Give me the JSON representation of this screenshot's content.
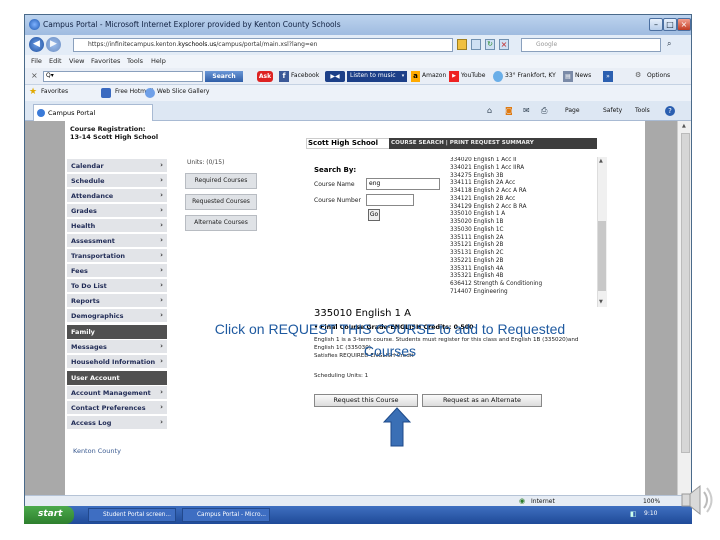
{
  "browser": {
    "title": "Campus Portal - Microsoft Internet Explorer provided by Kenton County Schools",
    "url_prefix": "https://infinitecampus.kenton.",
    "url_domain": "kyschools.us",
    "url_suffix": "/campus/portal/main.xsl?lang=en",
    "search_placeholder": "Google",
    "menu": [
      "File",
      "Edit",
      "View",
      "Favorites",
      "Tools",
      "Help"
    ],
    "toolbar": {
      "search_button": "Search",
      "facebook": "Facebook",
      "listen": "Listen to music",
      "amazon": "Amazon",
      "youtube": "YouTube",
      "weather": "33° Frankfort, KY",
      "news": "News",
      "options": "Options"
    },
    "favorites": {
      "label": "Favorites",
      "hotmail": "Free Hotmail",
      "webslice": "Web Slice Gallery"
    },
    "tab_label": "Campus Portal",
    "command_bar": {
      "page": "Page",
      "safety": "Safety",
      "tools": "Tools"
    },
    "status": {
      "zone": "Internet",
      "zoom": "100%"
    }
  },
  "sidebar": {
    "course_registration": "Course Registration:",
    "school_year": "13-14 Scott High School",
    "items": [
      "Calendar",
      "Schedule",
      "Attendance",
      "Grades",
      "Health",
      "Assessment",
      "Transportation",
      "Fees",
      "To Do List",
      "Reports",
      "Demographics"
    ],
    "family_header": "Family",
    "family_items": [
      "Messages",
      "Household Information"
    ],
    "user_header": "User Account",
    "user_items": [
      "Account Management",
      "Contact Preferences",
      "Access Log"
    ],
    "footer": "Kenton County"
  },
  "main": {
    "units_label": "Units: (0/15)",
    "left_buttons": [
      "Required Courses",
      "Requested Courses",
      "Alternate Courses"
    ],
    "school_name": "Scott High School",
    "tabs_text": "COURSE SEARCH | PRINT REQUEST SUMMARY",
    "search_by": "Search By:",
    "course_name_label": "Course Name",
    "course_name_value": "eng",
    "course_number_label": "Course Number",
    "course_number_value": "",
    "go_label": "Go",
    "course_list": [
      "334020 English 1 Acc II",
      "334021 English 1 Acc IIRA",
      "334275 English 3B",
      "334111 English 2A Acc",
      "334118 English 2 Acc A RA",
      "334121 English 2B Acc",
      "334129 English 2 Acc B RA",
      "335010 English 1 A",
      "335020 English 1B",
      "335030 English 1C",
      "335111 English 2A",
      "335121 English 2B",
      "335131 English 2C",
      "335221 English 2B",
      "335311 English 4A",
      "335321 English 4B",
      "636412 Strength & Conditioning",
      "714407 Engineering"
    ],
    "course_title": "335010 English 1 A",
    "grade_line": "• Final Course Grade-ENGLISH Credits: 0.500",
    "description": [
      "English 1 is a 3-term course. Students must register for this class and English 1B (335020)and",
      "English 1C (335030)",
      "Satisfies REQUIRED ENGLISH Credit"
    ],
    "scheduling_units": "Scheduling Units: 1",
    "request_button": "Request this Course",
    "alternate_button": "Request as an Alternate"
  },
  "caption": "Click on REQUEST THIS COURSE to add to Requested Courses",
  "taskbar": {
    "start": "start",
    "items": [
      "Student Portal screen...",
      "Campus Portal - Micro..."
    ],
    "clock": "9:10"
  },
  "colors": {
    "caption": "#1f5aa0",
    "arrow": "#3a6fb5",
    "sidebar_nav": "#1f2a55"
  }
}
